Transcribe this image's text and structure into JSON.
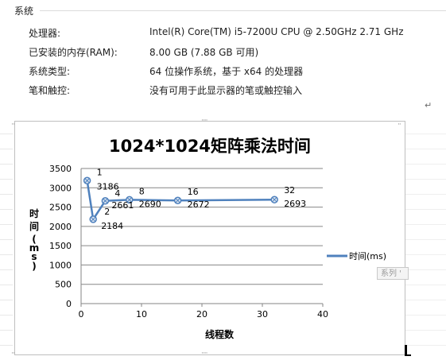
{
  "system": {
    "header": "系统",
    "rows": [
      {
        "label": "处理器:",
        "value": "Intel(R) Core(TM) i5-7200U CPU @ 2.50GHz   2.71 GHz"
      },
      {
        "label": "已安装的内存(RAM):",
        "value": "8.00 GB (7.88 GB 可用)"
      },
      {
        "label": "系统类型:",
        "value": "64 位操作系统，基于 x64 的处理器"
      },
      {
        "label": "笔和触控:",
        "value": "没有可用于此显示器的笔或触控输入"
      }
    ]
  },
  "chart_data": {
    "type": "line",
    "title": "1024*1024矩阵乘法时间",
    "xlabel": "线程数",
    "ylabel": "时间(ms)",
    "ylabel_chars": [
      "时",
      "间",
      "(",
      "m",
      "s",
      ")"
    ],
    "xlim": [
      0,
      40
    ],
    "ylim": [
      0,
      3500
    ],
    "xticks": [
      0,
      10,
      20,
      30,
      40
    ],
    "yticks": [
      0,
      500,
      1000,
      1500,
      2000,
      2500,
      3000,
      3500
    ],
    "grid": "horizontal",
    "legend_position": "right",
    "series_color": "#4f81bd",
    "series": [
      {
        "name": "时间(ms)",
        "x": [
          1,
          2,
          4,
          8,
          16,
          32
        ],
        "y": [
          3186,
          2184,
          2661,
          2690,
          2672,
          2693
        ]
      }
    ],
    "data_labels": [
      {
        "x_text": "1",
        "y_text": "3186"
      },
      {
        "x_text": "2",
        "y_text": "2184"
      },
      {
        "x_text": "4",
        "y_text": "2661"
      },
      {
        "x_text": "8",
        "y_text": "2690"
      },
      {
        "x_text": "16",
        "y_text": "2672"
      },
      {
        "x_text": "32",
        "y_text": "2693"
      }
    ]
  },
  "tooltip": "系列 '",
  "icons": [
    "return-mark-icon",
    "resize-handle-icon",
    "text-cursor-icon"
  ]
}
